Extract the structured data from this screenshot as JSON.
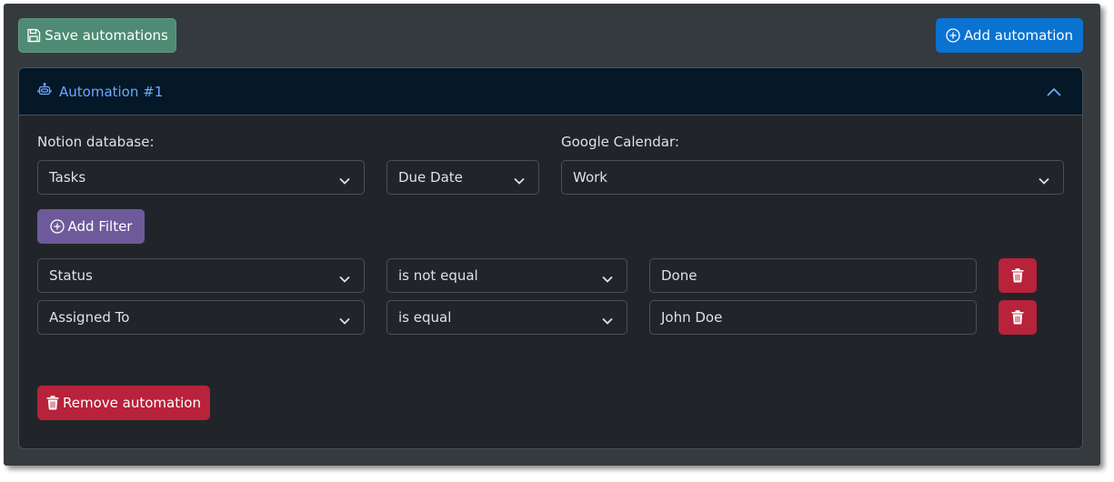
{
  "toolbar": {
    "save_label": "Save automations",
    "add_label": "Add automation"
  },
  "automation": {
    "title": "Automation #1",
    "notion_label": "Notion database:",
    "calendar_label": "Google Calendar:",
    "database_value": "Tasks",
    "date_property_value": "Due Date",
    "calendar_value": "Work",
    "add_filter_label": "Add Filter",
    "filters": [
      {
        "property": "Status",
        "operator": "is not equal",
        "value": "Done"
      },
      {
        "property": "Assigned To",
        "operator": "is equal",
        "value": "John Doe"
      }
    ],
    "remove_label": "Remove automation"
  },
  "colors": {
    "background": "#353a3f",
    "panel": "#212529",
    "header": "#041827",
    "accent_blue": "#0a72d1",
    "save_green": "#4f8a74",
    "filter_purple": "#6e5a9a",
    "danger_red": "#b8223a",
    "title_blue": "#6ea8fe"
  },
  "icons": {
    "save": "floppy-disk-icon",
    "add": "plus-circle-icon",
    "robot": "robot-icon",
    "collapse": "chevron-up-icon",
    "dropdown": "chevron-down-icon",
    "delete": "trash-icon"
  }
}
